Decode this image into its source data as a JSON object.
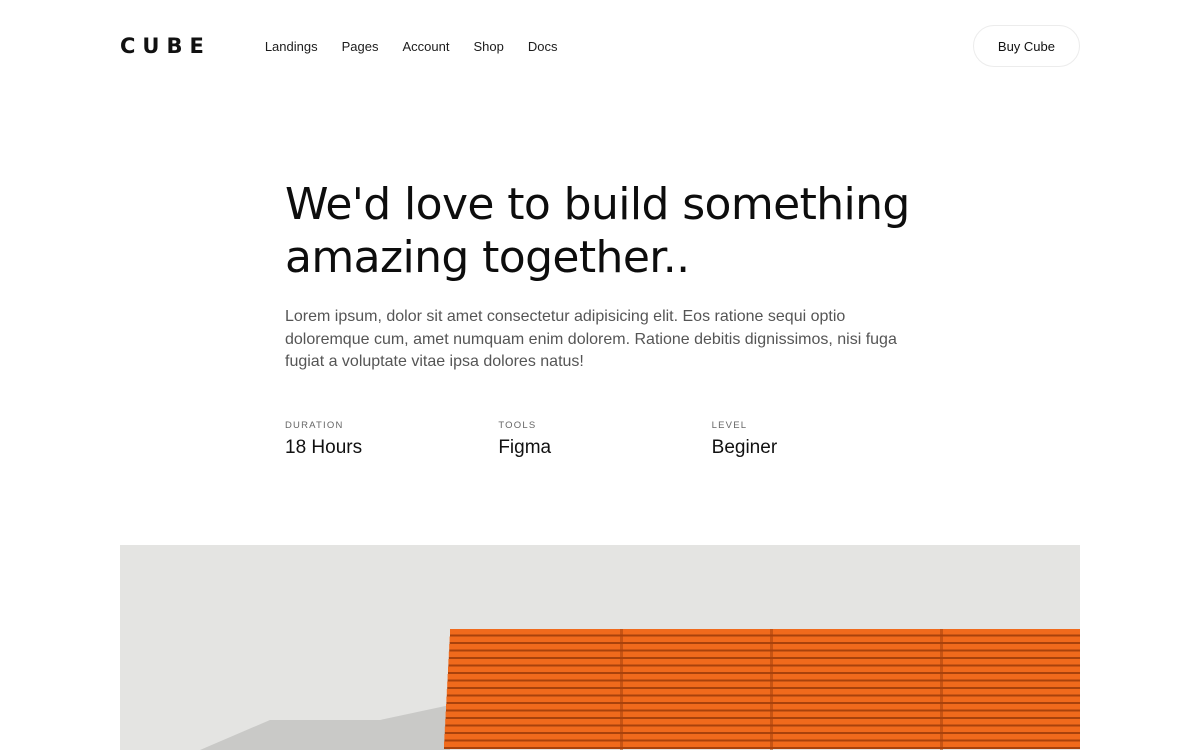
{
  "header": {
    "logo": "CUBE",
    "nav": [
      "Landings",
      "Pages",
      "Account",
      "Shop",
      "Docs"
    ],
    "buy_label": "Buy Cube"
  },
  "hero": {
    "title_line1": "We'd love to build something",
    "title_line2": "amazing together..",
    "description": "Lorem ipsum, dolor sit amet consectetur adipisicing elit. Eos ratione sequi optio doloremque cum, amet numquam enim dolorem. Ratione debitis dignissimos, nisi fuga fugiat a voluptate vitae ipsa dolores natus!"
  },
  "meta": [
    {
      "label": "DURATION",
      "value": "18 Hours"
    },
    {
      "label": "TOOLS",
      "value": "Figma"
    },
    {
      "label": "LEVEL",
      "value": "Beginer"
    }
  ],
  "photo": {
    "subject": "orange-bench-against-white-wall",
    "colors": {
      "wall": "#e4e4e2",
      "bench": "#f06a1c",
      "bench_dark": "#a8420c",
      "shadow": "#c9c9c7"
    }
  }
}
